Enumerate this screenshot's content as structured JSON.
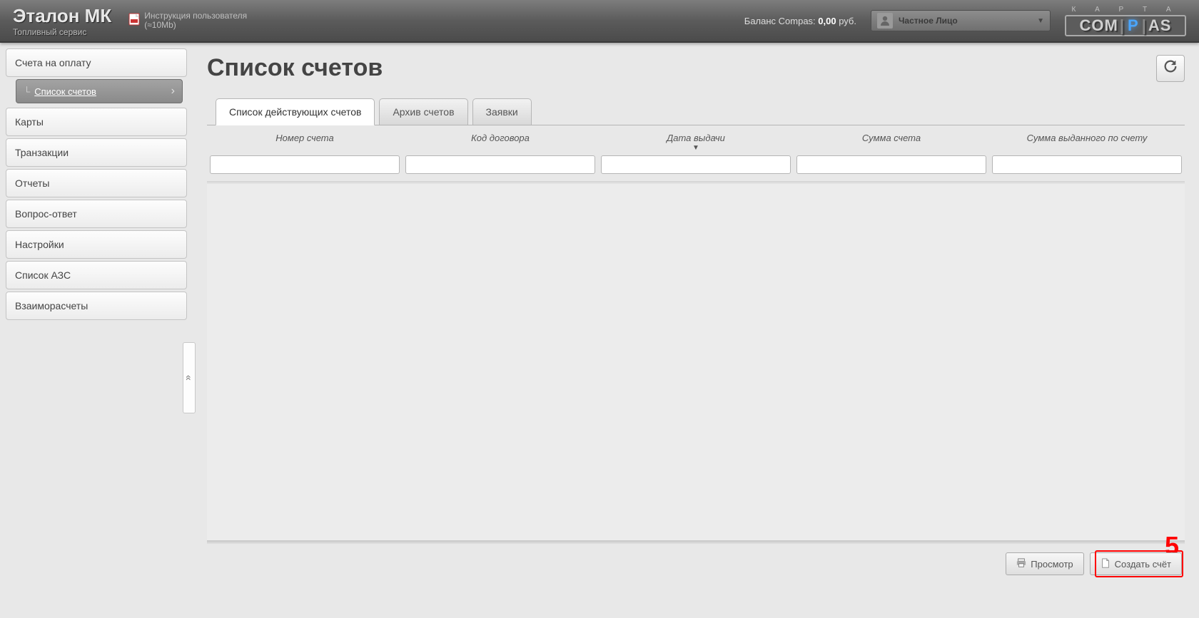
{
  "brand": {
    "title": "Эталон МК",
    "subtitle": "Топливный сервис"
  },
  "pdf": {
    "label": "Инструкция пользователя",
    "size": "(≈10Mb)"
  },
  "balance": {
    "prefix": "Баланс Compas: ",
    "value": "0,00",
    "suffix": " руб."
  },
  "user": {
    "name": "Частное Лицо"
  },
  "logo": {
    "top": "К  А  Р  Т  А"
  },
  "nav": {
    "item0": "Счета на оплату",
    "sub0": "Список счетов",
    "item1": "Карты",
    "item2": "Транзакции",
    "item3": "Отчеты",
    "item4": "Вопрос-ответ",
    "item5": "Настройки",
    "item6": "Список АЗС",
    "item7": "Взаиморасчеты"
  },
  "page": {
    "title": "Список счетов"
  },
  "tabs": {
    "t0": "Список действующих счетов",
    "t1": "Архив счетов",
    "t2": "Заявки"
  },
  "columns": {
    "c0": "Номер счета",
    "c1": "Код договора",
    "c2": "Дата выдачи",
    "c3": "Сумма счета",
    "c4": "Сумма выданного по счету"
  },
  "actions": {
    "preview": "Просмотр",
    "create": "Создать счёт"
  },
  "annotation": {
    "number": "5"
  },
  "collapse": "«"
}
